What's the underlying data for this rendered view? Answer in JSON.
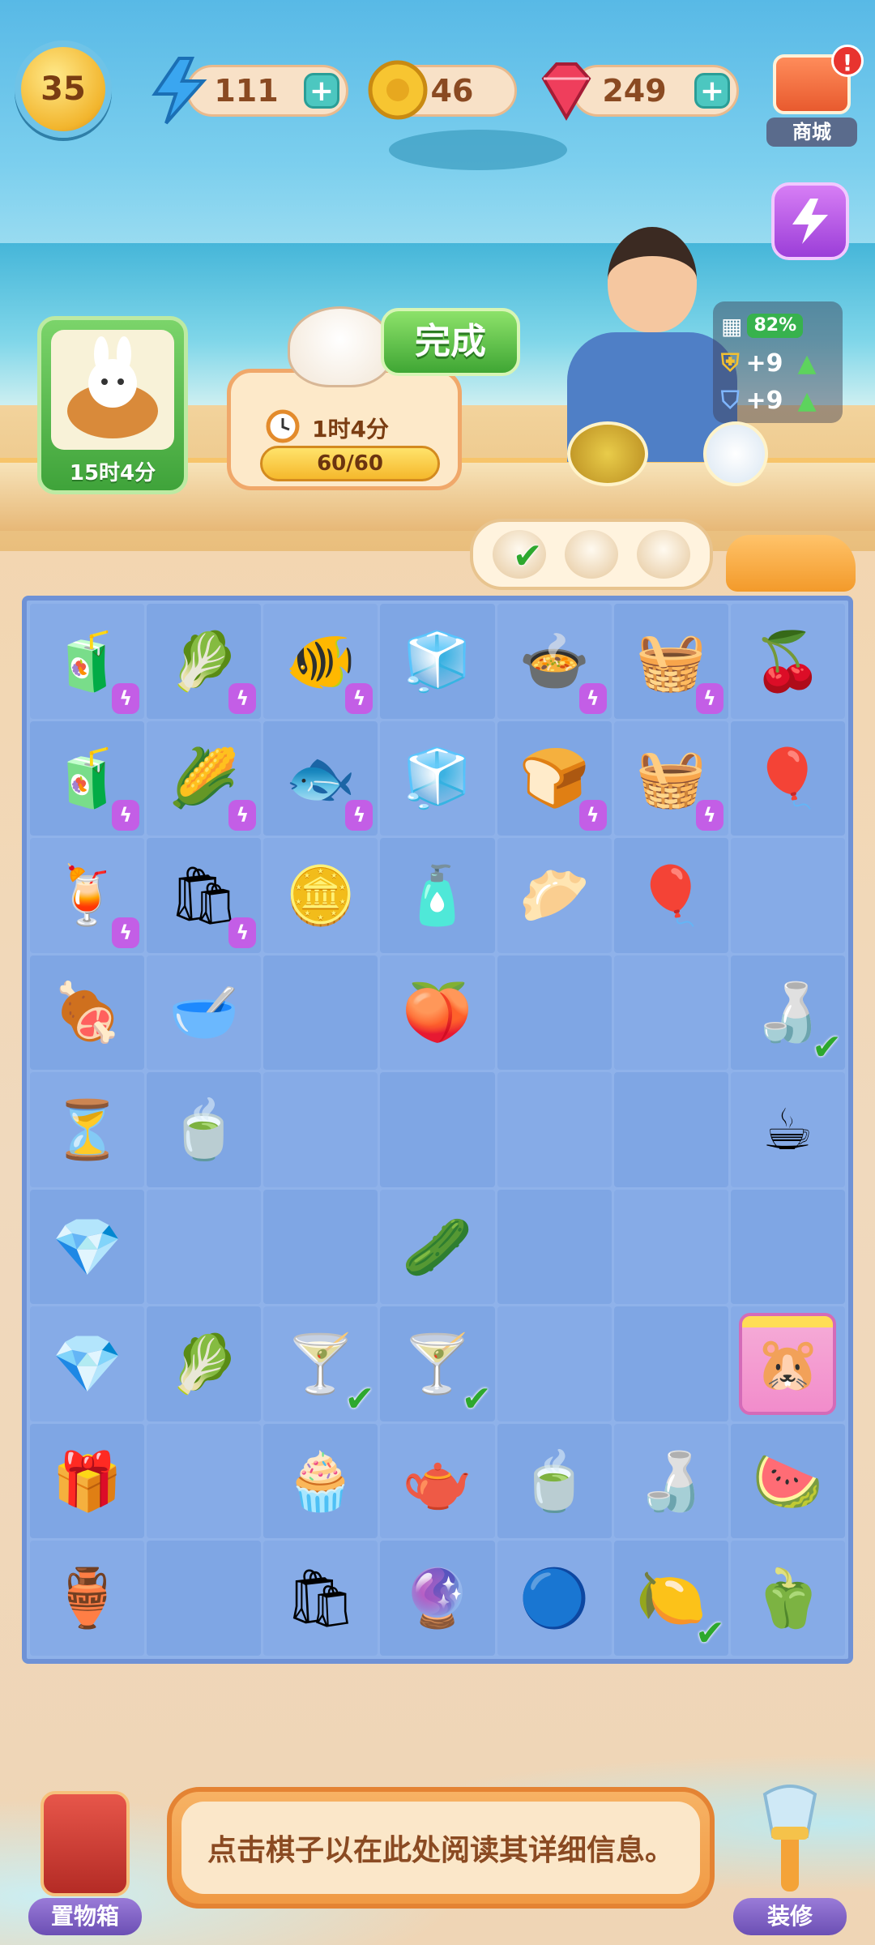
{
  "hud": {
    "level": "35",
    "energy": "111",
    "coins": "46",
    "gems": "249",
    "plus": "+"
  },
  "shop": {
    "label": "商城",
    "alert": "!"
  },
  "orders": {
    "left_timer": "15时4分",
    "cat_timer": "1时4分",
    "cat_progress": "60/60",
    "cat_progress_fraction": 1.0,
    "done_label": "完成"
  },
  "character_stats": {
    "bond_percent": "82%",
    "shield_bonus": "+9",
    "potion_bonus": "+9"
  },
  "board": {
    "rows": [
      [
        {
          "icon": "juicer-icon",
          "glyph": "🧃",
          "bolt": true
        },
        {
          "icon": "vegetable-basket-icon",
          "glyph": "🥬",
          "bolt": true
        },
        {
          "icon": "fishbowl-icon",
          "glyph": "🐠",
          "bolt": true
        },
        {
          "icon": "fridge-icon",
          "glyph": "🧊",
          "bolt": false
        },
        {
          "icon": "cooking-pot-icon",
          "glyph": "🍲",
          "bolt": true
        },
        {
          "icon": "cherry-basket-icon",
          "glyph": "🧺",
          "bolt": true
        },
        {
          "icon": "cherry-tree-icon",
          "glyph": "🍒",
          "bolt": false
        }
      ],
      [
        {
          "icon": "juicer-icon",
          "glyph": "🧃",
          "bolt": true
        },
        {
          "icon": "corn-basket-icon",
          "glyph": "🌽",
          "bolt": true
        },
        {
          "icon": "goldfish-bag-icon",
          "glyph": "🐟",
          "bolt": true
        },
        {
          "icon": "fridge-icon",
          "glyph": "🧊",
          "bolt": false
        },
        {
          "icon": "toaster-icon",
          "glyph": "🍞",
          "bolt": true
        },
        {
          "icon": "cherry-basket-icon",
          "glyph": "🧺",
          "bolt": true
        },
        {
          "icon": "balloons-icon",
          "glyph": "🎈",
          "bolt": false
        }
      ],
      [
        {
          "icon": "juice-jar-icon",
          "glyph": "🍹",
          "bolt": true
        },
        {
          "icon": "shopping-bag-icon",
          "glyph": "🛍",
          "bolt": true
        },
        {
          "icon": "coins-icon",
          "glyph": "🪙",
          "bolt": false
        },
        {
          "icon": "lotion-bottle-icon",
          "glyph": "🧴",
          "bolt": false
        },
        {
          "icon": "steamed-bun-icon",
          "glyph": "🥟",
          "bolt": false
        },
        {
          "icon": "balloon-icon",
          "glyph": "🎈",
          "bolt": false
        },
        {
          "icon": "empty",
          "glyph": "",
          "bolt": false
        }
      ],
      [
        {
          "icon": "roast-dish-icon",
          "glyph": "🍖",
          "bolt": false
        },
        {
          "icon": "soup-bowl-icon",
          "glyph": "🥣",
          "bolt": false
        },
        {
          "icon": "empty",
          "glyph": "",
          "bolt": false
        },
        {
          "icon": "peach-icon",
          "glyph": "🍑",
          "bolt": false
        },
        {
          "icon": "empty",
          "glyph": "",
          "bolt": false
        },
        {
          "icon": "empty",
          "glyph": "",
          "bolt": false
        },
        {
          "icon": "sake-bottle-icon",
          "glyph": "🍶",
          "bolt": false,
          "check": true
        }
      ],
      [
        {
          "icon": "hourglass-icon",
          "glyph": "⏳",
          "bolt": false
        },
        {
          "icon": "broth-bowl-icon",
          "glyph": "🍵",
          "bolt": false
        },
        {
          "icon": "empty",
          "glyph": "",
          "bolt": false
        },
        {
          "icon": "empty",
          "glyph": "",
          "bolt": false
        },
        {
          "icon": "empty",
          "glyph": "",
          "bolt": false
        },
        {
          "icon": "empty",
          "glyph": "",
          "bolt": false
        },
        {
          "icon": "tea-cup-icon",
          "glyph": "☕",
          "bolt": false
        }
      ],
      [
        {
          "icon": "gem-pile-icon",
          "glyph": "💎",
          "bolt": false
        },
        {
          "icon": "empty",
          "glyph": "",
          "bolt": false
        },
        {
          "icon": "empty",
          "glyph": "",
          "bolt": false
        },
        {
          "icon": "cucumber-icon",
          "glyph": "🥒",
          "bolt": false
        },
        {
          "icon": "empty",
          "glyph": "",
          "bolt": false
        },
        {
          "icon": "empty",
          "glyph": "",
          "bolt": false
        },
        {
          "icon": "empty",
          "glyph": "",
          "bolt": false
        }
      ],
      [
        {
          "icon": "gem-icon",
          "glyph": "💎",
          "bolt": false
        },
        {
          "icon": "cabbage-icon",
          "glyph": "🥬",
          "bolt": false
        },
        {
          "icon": "glass-icon",
          "glyph": "🍸",
          "bolt": false,
          "check": true
        },
        {
          "icon": "glass-icon",
          "glyph": "🍸",
          "bolt": false,
          "check": true
        },
        {
          "icon": "empty",
          "glyph": "",
          "bolt": false
        },
        {
          "icon": "empty",
          "glyph": "",
          "bolt": false
        },
        {
          "icon": "hamster-card-icon",
          "glyph": "🐹",
          "bolt": false,
          "special": true
        }
      ],
      [
        {
          "icon": "treasure-chest-icon",
          "glyph": "🎁",
          "bolt": false
        },
        {
          "icon": "empty",
          "glyph": "",
          "bolt": false
        },
        {
          "icon": "cream-bun-icon",
          "glyph": "🧁",
          "bolt": false
        },
        {
          "icon": "teapot-icon",
          "glyph": "🫖",
          "bolt": false
        },
        {
          "icon": "tea-cup-icon",
          "glyph": "🍵",
          "bolt": false
        },
        {
          "icon": "tea-set-icon",
          "glyph": "🍶",
          "bolt": false
        },
        {
          "icon": "watermelon-icon",
          "glyph": "🍉",
          "bolt": false
        }
      ],
      [
        {
          "icon": "treasure-bowl-icon",
          "glyph": "🏺",
          "bolt": false
        },
        {
          "icon": "empty",
          "glyph": "",
          "bolt": false
        },
        {
          "icon": "paper-bag-icon",
          "glyph": "🛍",
          "bolt": false
        },
        {
          "icon": "energy-bubble-purple-icon",
          "glyph": "🔮",
          "bolt": false
        },
        {
          "icon": "energy-bubble-blue-icon",
          "glyph": "🔵",
          "bolt": false
        },
        {
          "icon": "lemon-cake-icon",
          "glyph": "🍋",
          "bolt": false,
          "check": true
        },
        {
          "icon": "okra-icon",
          "glyph": "🫑",
          "bolt": false
        }
      ]
    ]
  },
  "bottom": {
    "storage_label": "置物箱",
    "info_text": "点击棋子以在此处阅读其详细信息。",
    "decorate_label": "装修"
  },
  "colors": {
    "board_bg": "#8fb2ea",
    "accent_green": "#3fa634",
    "accent_purple": "#9b3ed8"
  }
}
